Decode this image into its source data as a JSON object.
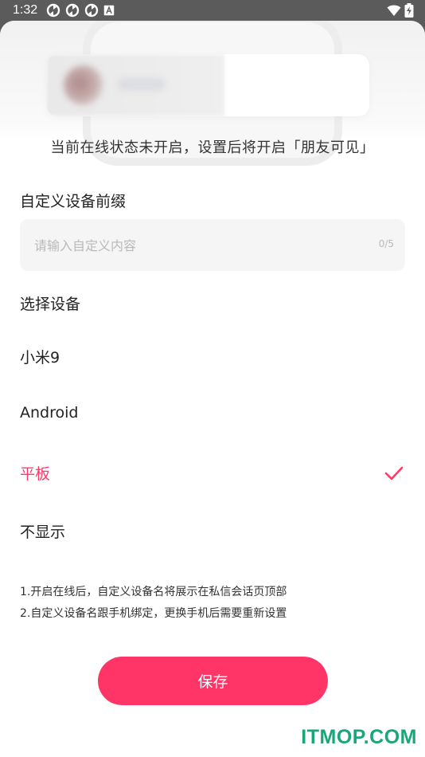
{
  "status_bar": {
    "time": "1:32",
    "left_icons": [
      "sync-icon",
      "sync-icon",
      "sync-icon",
      "a-box-icon"
    ],
    "right_icons": [
      "wifi-icon",
      "battery-charging-icon"
    ]
  },
  "sheet": {
    "hint": "当前在线状态未开启，设置后将开启「朋友可见」",
    "prefix_title": "自定义设备前缀",
    "input": {
      "placeholder": "请输入自定义内容",
      "value": "",
      "counter": "0/5"
    },
    "device_title": "选择设备",
    "devices": [
      {
        "label": "小米9",
        "selected": false
      },
      {
        "label": "Android",
        "selected": false
      },
      {
        "label": "平板",
        "selected": true
      },
      {
        "label": "不显示",
        "selected": false
      }
    ],
    "notes": [
      "1.开启在线后，自定义设备名将展示在私信会话页顶部",
      "2.自定义设备名跟手机绑定，更换手机后需要重新设置"
    ],
    "save_label": "保存"
  },
  "colors": {
    "accent": "#ff3a6b",
    "button": "#ff3567",
    "watermark": "#1aa67a"
  },
  "watermark": "ITMOP.COM"
}
